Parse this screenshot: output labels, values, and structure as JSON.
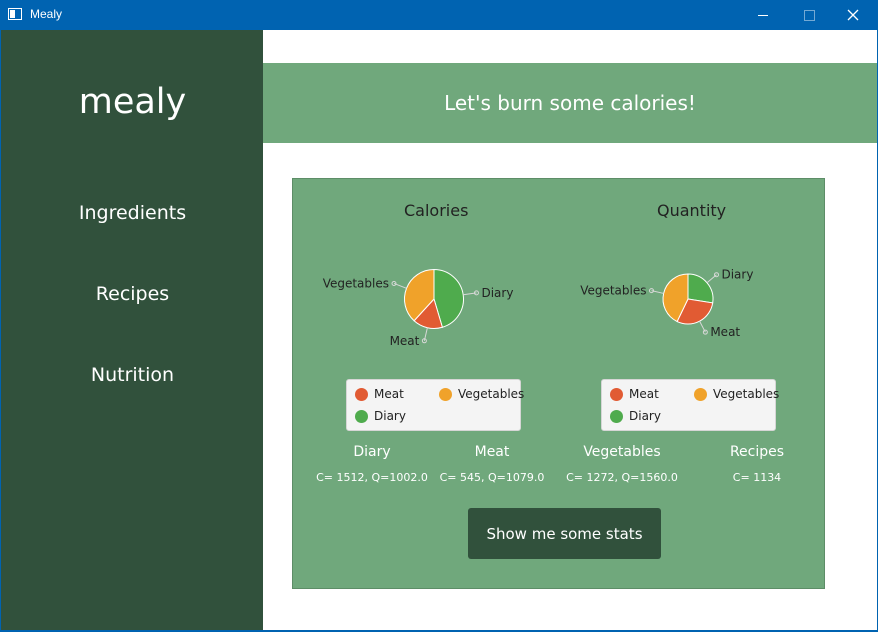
{
  "window": {
    "title": "Mealy",
    "icon": "app-window-icon"
  },
  "sidebar": {
    "brand": "mealy",
    "items": [
      {
        "label": "Ingredients"
      },
      {
        "label": "Recipes"
      },
      {
        "label": "Nutrition"
      }
    ]
  },
  "banner": {
    "text": "Let's burn some calories!"
  },
  "colors": {
    "meat": "#e15b33",
    "vegetables": "#f0a22a",
    "diary": "#4fab4d",
    "sidebar": "#31513c",
    "panel": "#70a87c",
    "titlebar": "#0063b1"
  },
  "chart_data": [
    {
      "type": "pie",
      "title": "Calories",
      "categories": [
        "Diary",
        "Meat",
        "Vegetables"
      ],
      "values": [
        1512,
        545,
        1272
      ],
      "legend": [
        "Meat",
        "Vegetables",
        "Diary"
      ],
      "legend_position": "bottom"
    },
    {
      "type": "pie",
      "title": "Quantity",
      "categories": [
        "Diary",
        "Meat",
        "Vegetables"
      ],
      "values": [
        1002.0,
        1079.0,
        1560.0
      ],
      "legend": [
        "Meat",
        "Vegetables",
        "Diary"
      ],
      "legend_position": "bottom"
    }
  ],
  "stats": [
    {
      "name": "Diary",
      "value": "C= 1512, Q=1002.0"
    },
    {
      "name": "Meat",
      "value": "C= 545, Q=1079.0"
    },
    {
      "name": "Vegetables",
      "value": "C= 1272, Q=1560.0"
    },
    {
      "name": "Recipes",
      "value": "C= 1134"
    }
  ],
  "button": {
    "label": "Show me some stats"
  }
}
